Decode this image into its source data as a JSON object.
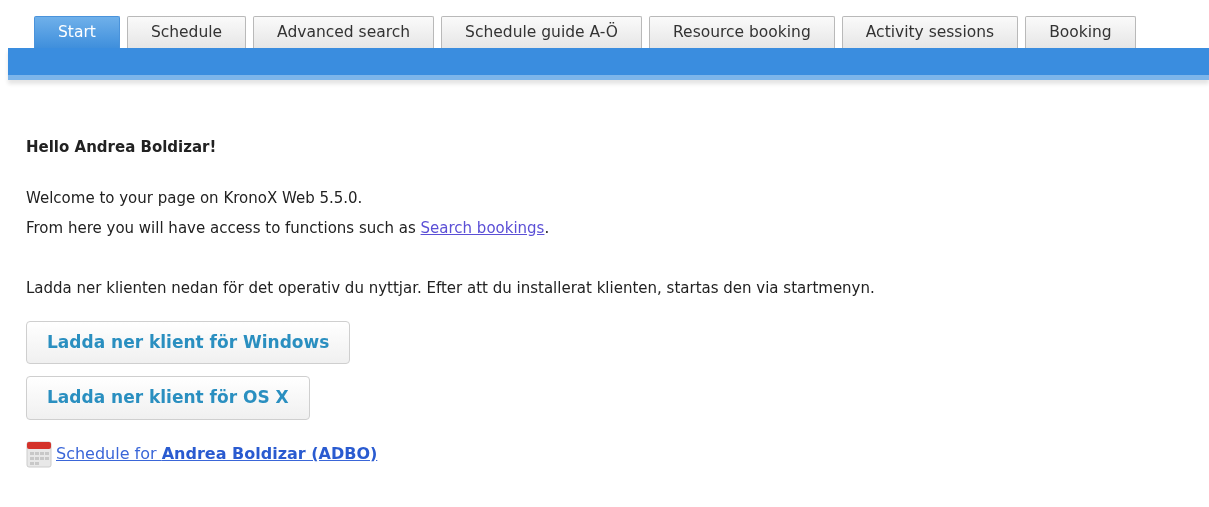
{
  "tabs": [
    {
      "label": "Start",
      "selected": true
    },
    {
      "label": "Schedule",
      "selected": false
    },
    {
      "label": "Advanced search",
      "selected": false
    },
    {
      "label": "Schedule guide A-Ö",
      "selected": false
    },
    {
      "label": "Resource booking",
      "selected": false
    },
    {
      "label": "Activity sessions",
      "selected": false
    },
    {
      "label": "Booking",
      "selected": false
    }
  ],
  "greeting": "Hello Andrea Boldizar!",
  "welcome": "Welcome to your page on KronoX Web 5.5.0.",
  "access": {
    "before": "From here you will have access to functions such as ",
    "link": "Search bookings",
    "after": "."
  },
  "instructions": "Ladda ner klienten nedan för det operativ du nyttjar. Efter att du installerat klienten, startas den via startmenyn.",
  "download_buttons": [
    "Ladda ner klient för Windows",
    "Ladda ner klient för OS X"
  ],
  "schedule_link": "Schedule for **Andrea Boldizar (ADBO)**"
}
